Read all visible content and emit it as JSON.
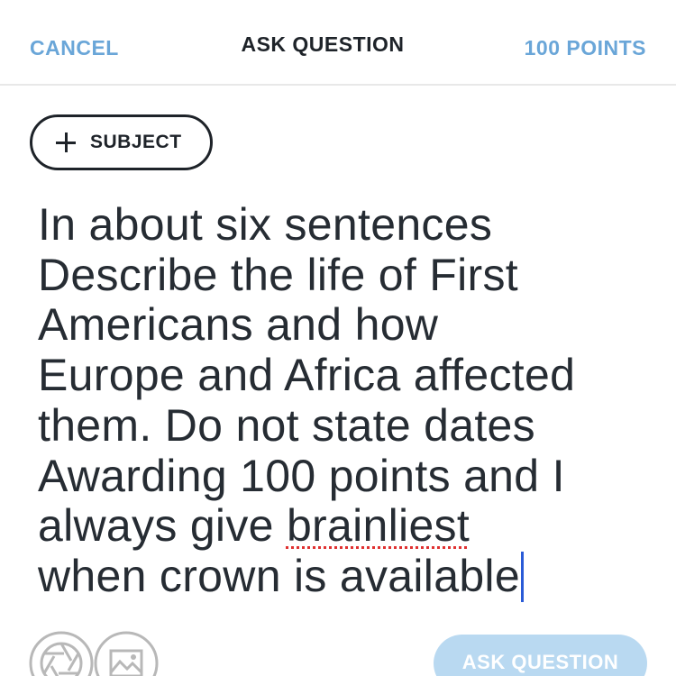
{
  "header": {
    "cancel_label": "CANCEL",
    "title": "ASK QUESTION",
    "points_label": "100 POINTS"
  },
  "subject": {
    "label": "SUBJECT",
    "icon": "plus-icon"
  },
  "question": {
    "lines": [
      "In about six sentences",
      "Describe the life of First",
      "Americans and how",
      "Europe and Africa affected",
      "them. Do not state dates",
      "Awarding 100 points and I",
      "always give ",
      "brainliest",
      "when crown is available"
    ],
    "misspelled_word": "brainliest"
  },
  "footer": {
    "camera_icon": "camera-icon",
    "image_icon": "image-icon",
    "ask_label": "ASK QUESTION"
  },
  "colors": {
    "accent": "#6aa6d8",
    "text": "#1e2329",
    "ask_button_bg": "#b9d9f1",
    "caret": "#2a5bd7",
    "spellcheck": "#e03030"
  }
}
